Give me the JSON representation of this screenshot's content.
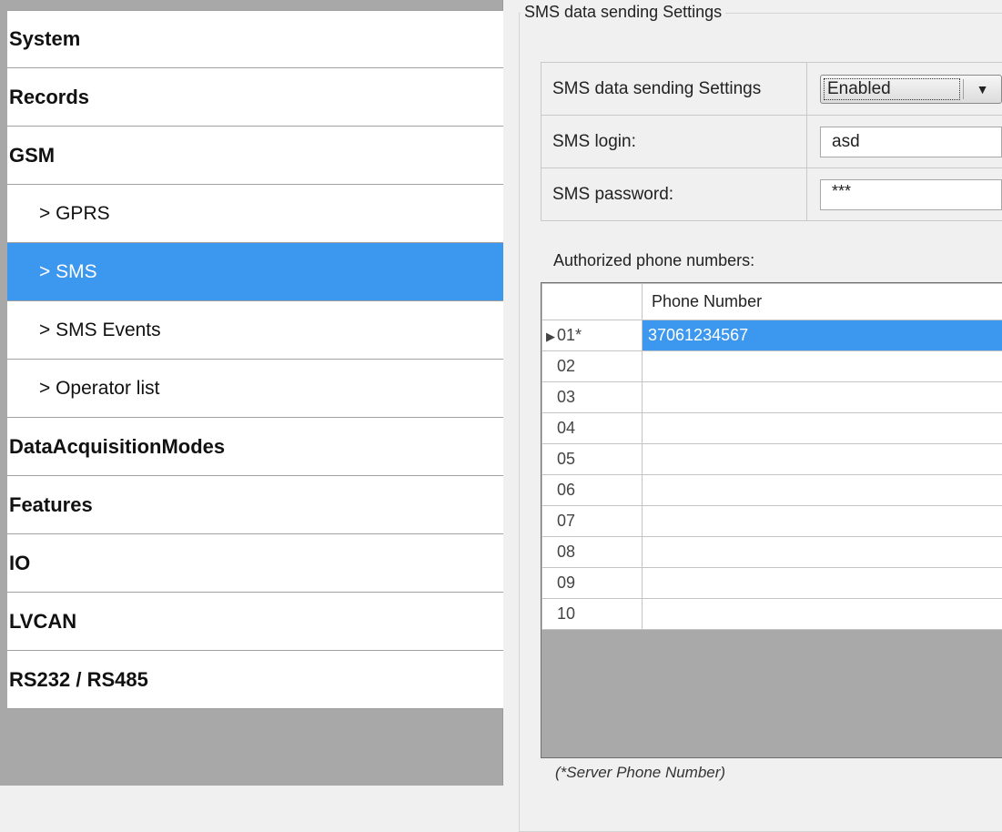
{
  "sidebar": {
    "items": [
      {
        "label": "System",
        "kind": "category"
      },
      {
        "label": "Records",
        "kind": "category"
      },
      {
        "label": "GSM",
        "kind": "category"
      },
      {
        "label": "> GPRS",
        "kind": "sub"
      },
      {
        "label": "> SMS",
        "kind": "sub",
        "selected": true
      },
      {
        "label": "> SMS Events",
        "kind": "sub"
      },
      {
        "label": "> Operator list",
        "kind": "sub"
      },
      {
        "label": "DataAcquisitionModes",
        "kind": "category"
      },
      {
        "label": "Features",
        "kind": "category"
      },
      {
        "label": "IO",
        "kind": "category"
      },
      {
        "label": "LVCAN",
        "kind": "category"
      },
      {
        "label": "RS232 / RS485",
        "kind": "category"
      }
    ]
  },
  "panel": {
    "group_title": "SMS data sending Settings",
    "settings": {
      "sending_label": "SMS data sending Settings",
      "sending_value": "Enabled",
      "login_label": "SMS login:",
      "login_value": "asd",
      "password_label": "SMS password:",
      "password_value": "***"
    },
    "authorized_label": "Authorized phone numbers:",
    "phone_table": {
      "column_header": "Phone Number",
      "rows": [
        {
          "id": "01*",
          "number": "37061234567",
          "selected": true
        },
        {
          "id": "02",
          "number": ""
        },
        {
          "id": "03",
          "number": ""
        },
        {
          "id": "04",
          "number": ""
        },
        {
          "id": "05",
          "number": ""
        },
        {
          "id": "06",
          "number": ""
        },
        {
          "id": "07",
          "number": ""
        },
        {
          "id": "08",
          "number": ""
        },
        {
          "id": "09",
          "number": ""
        },
        {
          "id": "10",
          "number": ""
        }
      ]
    },
    "footnote": "(*Server Phone Number)"
  },
  "colors": {
    "selection": "#3c97ef",
    "sidebar_bg": "#a8a8a8",
    "panel_bg": "#f0f0f0"
  },
  "icons": {
    "dropdown": "chevron-down-icon",
    "row_marker": "row-pointer-icon"
  }
}
